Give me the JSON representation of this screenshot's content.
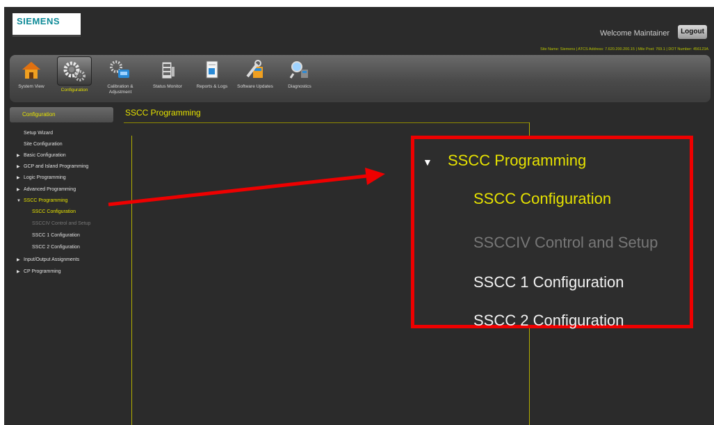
{
  "logo": "SIEMENS",
  "header": {
    "welcome": "Welcome Maintainer",
    "logout_label": "Logout",
    "site_info": "Site Name: Siemens | ATCS Address: 7.620.200.200.15 | Mile Post: 769.1 | DOT Number: 456123A"
  },
  "toolbar": {
    "items": [
      {
        "label": "System View",
        "icon": "house-icon"
      },
      {
        "label": "Configuration",
        "icon": "gears-icon",
        "active": true
      },
      {
        "label": "Calibration & Adjustment",
        "icon": "calibration-icon"
      },
      {
        "label": "Status Monitor",
        "icon": "monitor-icon"
      },
      {
        "label": "Reports & Logs",
        "icon": "report-icon"
      },
      {
        "label": "Software Updates",
        "icon": "wrench-icon"
      },
      {
        "label": "Diagnostics",
        "icon": "magnifier-icon"
      }
    ]
  },
  "sidebar": {
    "header": "Configuration",
    "items": [
      {
        "label": "Setup Wizard"
      },
      {
        "label": "Site Configuration"
      },
      {
        "label": "Basic Configuration"
      },
      {
        "label": "GCP and Island Programming"
      },
      {
        "label": "Logic Programming"
      },
      {
        "label": "Advanced Programming"
      },
      {
        "label": "SSCC Programming"
      },
      {
        "label": "SSCC Configuration"
      },
      {
        "label": "SSCCIV Control and Setup"
      },
      {
        "label": "SSCC 1 Configuration"
      },
      {
        "label": "SSCC 2 Configuration"
      },
      {
        "label": "Input/Output Assignments"
      },
      {
        "label": "CP Programming"
      }
    ]
  },
  "main": {
    "title": "SSCC Programming"
  },
  "zoom": {
    "items": [
      {
        "label": "SSCC Programming"
      },
      {
        "label": "SSCC Configuration"
      },
      {
        "label": "SSCCIV Control and Setup"
      },
      {
        "label": "SSCC 1 Configuration"
      },
      {
        "label": "SSCC 2 Configuration"
      }
    ]
  },
  "colors": {
    "accent": "#e6e200",
    "highlight_box": "#ee0000",
    "background": "#2b2b2b"
  }
}
